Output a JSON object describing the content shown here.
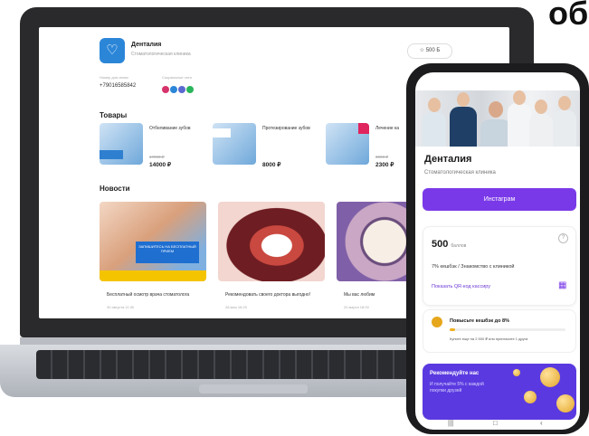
{
  "corner_heading": "об",
  "laptop": {
    "clinic_name": "Денталия",
    "clinic_subtitle": "Стоматологическая клиника",
    "balance_button": "☆ 500 Б",
    "phone_label": "Номер для связи",
    "phone_value": "+79016585842",
    "social_label": "Социальные сети",
    "social_colors": [
      "#d6336c",
      "#2c86d8",
      "#5b6ad0",
      "#29b55b"
    ],
    "products_heading": "Товары",
    "products": [
      {
        "title": "Отбеливание зубов",
        "old_price": "17000 ₽",
        "price": "14000 ₽"
      },
      {
        "title": "Протезирование зубов",
        "old_price": "",
        "price": "8000 ₽"
      },
      {
        "title": "Лечение ка",
        "old_price": "3000 ₽",
        "price": "2300 ₽"
      }
    ],
    "news_heading": "Новости",
    "news": [
      {
        "banner": "ЗАПИШИТЕСЬ НА БЕСПЛАТНЫЙ ПРИЕМ",
        "title": "Бесплатный осмотр врача стоматолога",
        "date": "30 августа 11:30"
      },
      {
        "banner": "",
        "title": "Рекомендовать своего доктора выгодно!",
        "date": "28 мая 16:25"
      },
      {
        "banner": "",
        "title": "Мы вас любим",
        "date": "20 марта 18:00"
      }
    ]
  },
  "phone": {
    "clinic_name": "Денталия",
    "clinic_subtitle": "Стоматологическая клиника",
    "instagram_button": "Инстаграм",
    "points_value": "500",
    "points_unit": "баллов",
    "cashback_text": "7% кешбэк / Знакомство с клиникой",
    "qr_link": "Показать QR-код кассиру",
    "upgrade_title": "Повысьте кешбэк до 8%",
    "upgrade_progress": 0.05,
    "upgrade_note": "Купите еще на 2 500 ₽ или пригласите 1 друга",
    "referral_title": "Рекомендуйте нас",
    "referral_text": "И получайте 5% с каждой покупки друзей",
    "nav_icons": [
      "menu-icon",
      "home-icon",
      "back-icon"
    ]
  }
}
